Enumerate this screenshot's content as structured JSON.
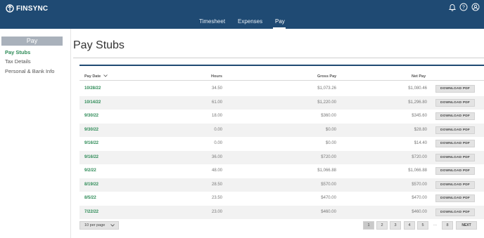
{
  "app": {
    "logo_text": "FINSYNC"
  },
  "nav": {
    "items": [
      "Timesheet",
      "Expenses",
      "Pay"
    ],
    "active": "Pay"
  },
  "sidebar": {
    "header": "Pay",
    "items": [
      {
        "label": "Pay Stubs",
        "active": true
      },
      {
        "label": "Tax Details",
        "active": false
      },
      {
        "label": "Personal & Bank Info",
        "active": false
      }
    ]
  },
  "main": {
    "title": "Pay Stubs",
    "columns": {
      "pay_date": "Pay Date",
      "hours": "Hours",
      "gross_pay": "Gross Pay",
      "net_pay": "Net Pay"
    },
    "download_label": "DOWNLOAD PDF",
    "rows": [
      {
        "date": "10/28/22",
        "hours": "34.50",
        "gross": "$1,073.26",
        "net": "$1,080.46"
      },
      {
        "date": "10/14/22",
        "hours": "61.00",
        "gross": "$1,220.00",
        "net": "$1,296.80"
      },
      {
        "date": "9/30/22",
        "hours": "18.00",
        "gross": "$360.00",
        "net": "$345.60"
      },
      {
        "date": "9/30/22",
        "hours": "0.00",
        "gross": "$0.00",
        "net": "$28.80"
      },
      {
        "date": "9/16/22",
        "hours": "0.00",
        "gross": "$0.00",
        "net": "$14.40"
      },
      {
        "date": "9/16/22",
        "hours": "36.00",
        "gross": "$720.00",
        "net": "$720.00"
      },
      {
        "date": "9/2/22",
        "hours": "48.00",
        "gross": "$1,066.88",
        "net": "$1,066.88"
      },
      {
        "date": "8/19/22",
        "hours": "28.50",
        "gross": "$570.00",
        "net": "$570.00"
      },
      {
        "date": "8/5/22",
        "hours": "23.50",
        "gross": "$470.00",
        "net": "$470.00"
      },
      {
        "date": "7/22/22",
        "hours": "23.00",
        "gross": "$460.00",
        "net": "$460.00"
      }
    ]
  },
  "pagination": {
    "per_page": "10 per page",
    "pages": [
      "1",
      "2",
      "3",
      "4",
      "5"
    ],
    "ellipsis": "...",
    "last_page": "8",
    "next": "NEXT",
    "current": "1"
  },
  "colors": {
    "nav_bg": "#1f4a73",
    "accent_green": "#2e8b57",
    "sidebar_header_bg": "#a9b1bb"
  },
  "icons": {
    "logo": "finsync-logo-icon",
    "bell": "bell-icon",
    "help": "help-icon",
    "user": "user-icon",
    "sort": "sort-down-icon"
  }
}
